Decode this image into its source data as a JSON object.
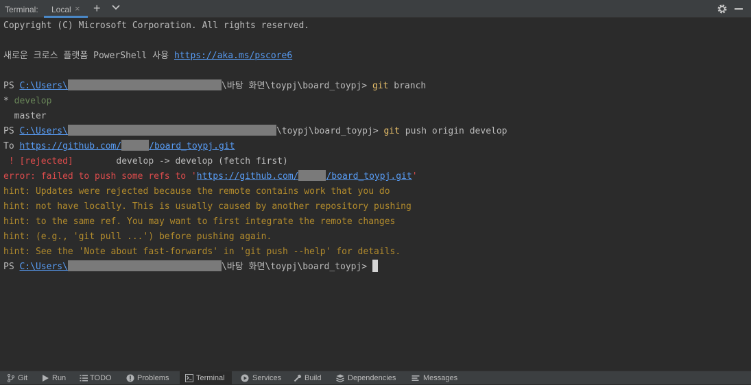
{
  "titlebar": {
    "label": "Terminal:",
    "tab_label": "Local",
    "tab_close": "×",
    "plus": "+"
  },
  "terminal": {
    "copyright": "Copyright (C) Microsoft Corporation. All rights reserved.",
    "ps_intro": "새로운 크로스 플랫폼 PowerShell 사용 ",
    "ps_link": "https://aka.ms/pscore6",
    "prompt_prefix": "PS ",
    "users_link": "C:\\Users\\",
    "path_desktop": "\\바탕 화면\\toypj\\board_toypj> ",
    "path_short": "\\toypj\\board_toypj> ",
    "cmd_git": "git",
    "cmd_branch_args": " branch",
    "branch_star": "* ",
    "branch_develop": "develop",
    "branch_master": "  master",
    "cmd_push_args": " push origin develop",
    "to_prefix": "To ",
    "gh_link_start": "https://github.com/",
    "gh_link_end": "/board_toypj.git",
    "rejected_tag": " ! [rejected]",
    "rejected_rest": "        develop -> develop (fetch first)",
    "error_prefix": "error: failed to push some refs to '",
    "error_suffix": "'",
    "hints": [
      "hint: Updates were rejected because the remote contains work that you do",
      "hint: not have locally. This is usually caused by another repository pushing",
      "hint: to the same ref. You may want to first integrate the remote changes",
      "hint: (e.g., 'git pull ...') before pushing again.",
      "hint: See the 'Note about fast-forwards' in 'git push --help' for details."
    ]
  },
  "bottombar": {
    "tabs": [
      {
        "label": "Git",
        "icon": "git-branch-icon"
      },
      {
        "label": "Run",
        "icon": "run-icon"
      },
      {
        "label": "TODO",
        "icon": "todo-icon"
      },
      {
        "label": "Problems",
        "icon": "problems-icon"
      },
      {
        "label": "Terminal",
        "icon": "terminal-icon",
        "active": true
      },
      {
        "label": "Services",
        "icon": "services-icon"
      },
      {
        "label": "Build",
        "icon": "build-icon"
      },
      {
        "label": "Dependencies",
        "icon": "dependencies-icon"
      },
      {
        "label": "Messages",
        "icon": "messages-icon"
      }
    ]
  },
  "colors": {
    "background": "#2b2b2b",
    "link": "#589df6",
    "command": "#e8bf6a",
    "branch_current": "#6a8759",
    "error": "#de4c4c",
    "hint": "#b28b2c",
    "tab_underline": "#4a88c7"
  }
}
